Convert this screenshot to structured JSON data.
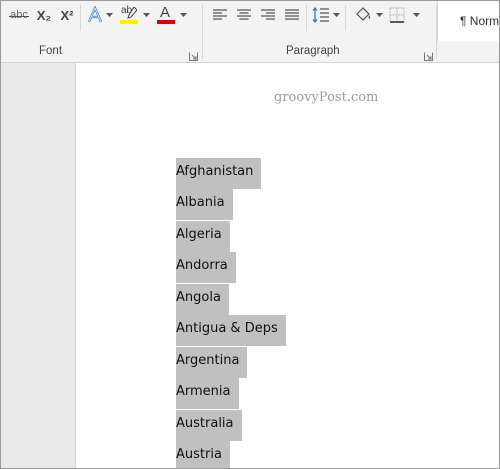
{
  "ribbon": {
    "font_group_label": "Font",
    "paragraph_group_label": "Paragraph",
    "style_preview": "¶ Norm",
    "buttons": {
      "strikethrough": "abc",
      "subscript": "X₂",
      "superscript": "X²",
      "highlight": "ab",
      "font_color": "A"
    },
    "colors": {
      "highlight_bar": "#fff200",
      "font_color_bar": "#e00000",
      "text_effects": "#2e75b6"
    }
  },
  "document": {
    "watermark": "groovyPost.com",
    "countries": [
      "Afghanistan",
      "Albania",
      "Algeria",
      "Andorra",
      "Angola",
      "Antigua & Deps",
      "Argentina",
      "Armenia",
      "Australia",
      "Austria"
    ],
    "selection_color": "#c0c0c0"
  }
}
